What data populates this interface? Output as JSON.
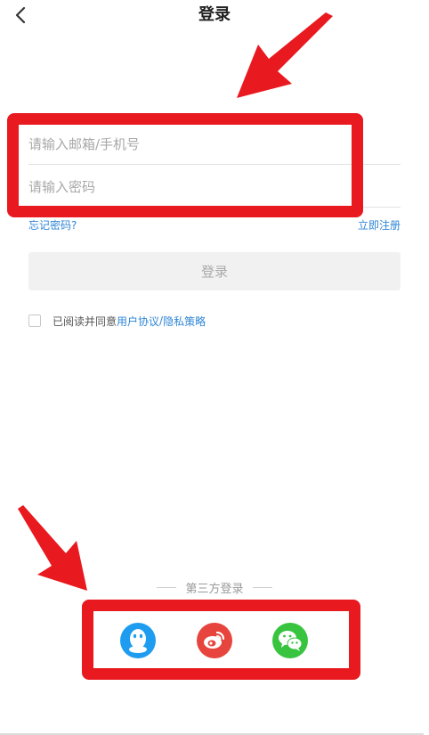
{
  "header": {
    "title": "登录"
  },
  "form": {
    "email_placeholder": "请输入邮箱/手机号",
    "password_placeholder": "请输入密码",
    "forgot_password": "忘记密码?",
    "register": "立即注册",
    "login_button": "登录"
  },
  "agreement": {
    "prefix": "已阅读并同意",
    "user_agreement": "用户协议",
    "separator": "/",
    "privacy_policy": "隐私策略"
  },
  "third_party": {
    "title": "第三方登录",
    "providers": [
      {
        "name": "QQ",
        "icon": "qq-icon",
        "color": "#1e9cf0"
      },
      {
        "name": "微博",
        "icon": "weibo-icon",
        "color": "#e6443c"
      },
      {
        "name": "微信",
        "icon": "wechat-icon",
        "color": "#38c43f"
      }
    ]
  },
  "colors": {
    "link": "#2f86d6",
    "annotation": "#e8191f",
    "button_disabled_bg": "#f1f1f1"
  }
}
